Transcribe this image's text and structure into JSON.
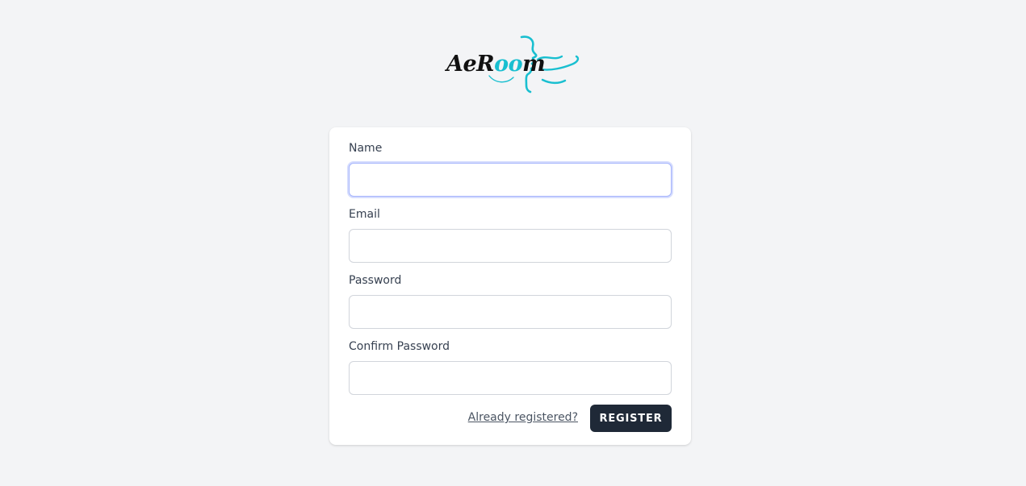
{
  "brand": {
    "logo_text_prefix": "AeR",
    "logo_text_oo": "oo",
    "logo_text_suffix": "m",
    "accent_color": "#19bfd0"
  },
  "form": {
    "fields": [
      {
        "label": "Name",
        "value": "",
        "placeholder": "",
        "type": "text",
        "focused": true
      },
      {
        "label": "Email",
        "value": "",
        "placeholder": "",
        "type": "email",
        "focused": false
      },
      {
        "label": "Password",
        "value": "",
        "placeholder": "",
        "type": "password",
        "focused": false
      },
      {
        "label": "Confirm Password",
        "value": "",
        "placeholder": "",
        "type": "password",
        "focused": false
      }
    ],
    "login_link": "Already registered?",
    "submit_label": "Register"
  },
  "colors": {
    "background": "#f3f4f6",
    "card": "#ffffff",
    "button": "#1f2937",
    "focus_ring": "#a5b4fc"
  }
}
